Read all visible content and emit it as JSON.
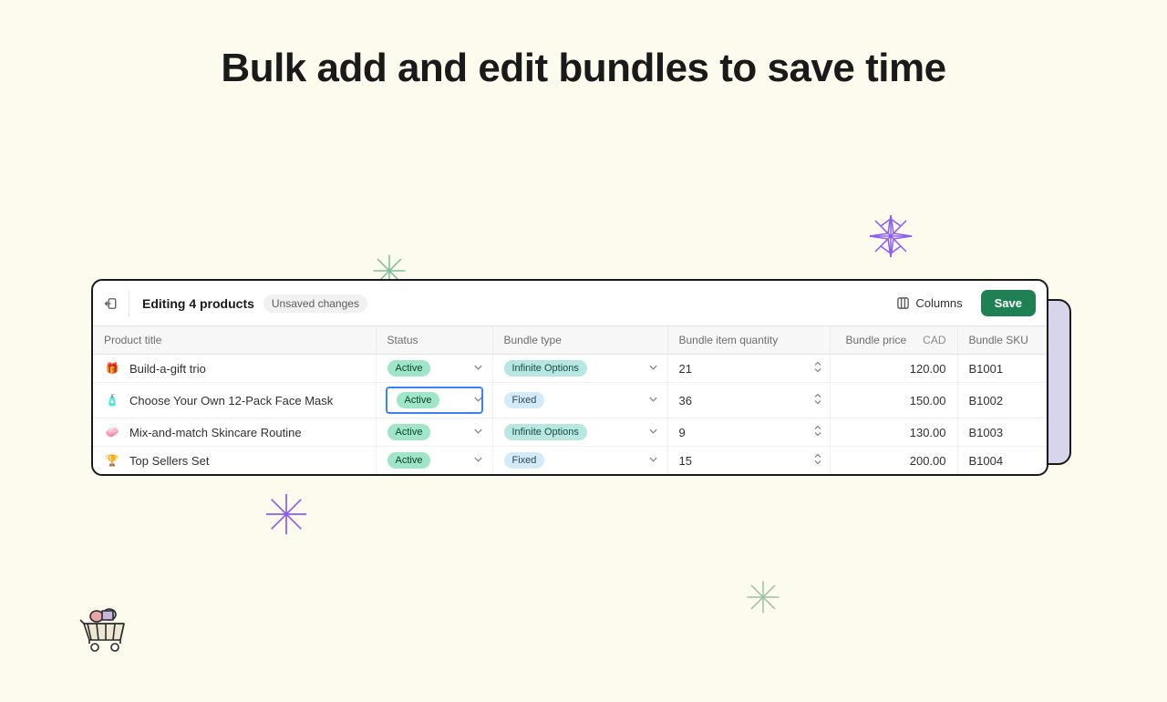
{
  "headline": "Bulk add and edit bundles to save time",
  "header": {
    "title": "Editing 4 products",
    "unsaved_label": "Unsaved changes",
    "columns_label": "Columns",
    "save_label": "Save"
  },
  "columns": {
    "title": "Product title",
    "status": "Status",
    "type": "Bundle type",
    "qty": "Bundle item quantity",
    "price": "Bundle price",
    "currency": "CAD",
    "sku": "Bundle SKU"
  },
  "rows": [
    {
      "emoji": "🎁",
      "title": "Build-a-gift trio",
      "status": "Active",
      "type": "Infinite Options",
      "type_variant": "infinite",
      "qty": "21",
      "price": "120.00",
      "sku": "B1001",
      "selected": false
    },
    {
      "emoji": "🧴",
      "title": "Choose Your Own 12-Pack Face Mask",
      "status": "Active",
      "type": "Fixed",
      "type_variant": "fixed",
      "qty": "36",
      "price": "150.00",
      "sku": "B1002",
      "selected": true
    },
    {
      "emoji": "🧼",
      "title": "Mix-and-match Skincare Routine",
      "status": "Active",
      "type": "Infinite Options",
      "type_variant": "infinite",
      "qty": "9",
      "price": "130.00",
      "sku": "B1003",
      "selected": false
    },
    {
      "emoji": "🏆",
      "title": "Top Sellers Set",
      "status": "Active",
      "type": "Fixed",
      "type_variant": "fixed",
      "qty": "15",
      "price": "200.00",
      "sku": "B1004",
      "selected": false
    }
  ]
}
